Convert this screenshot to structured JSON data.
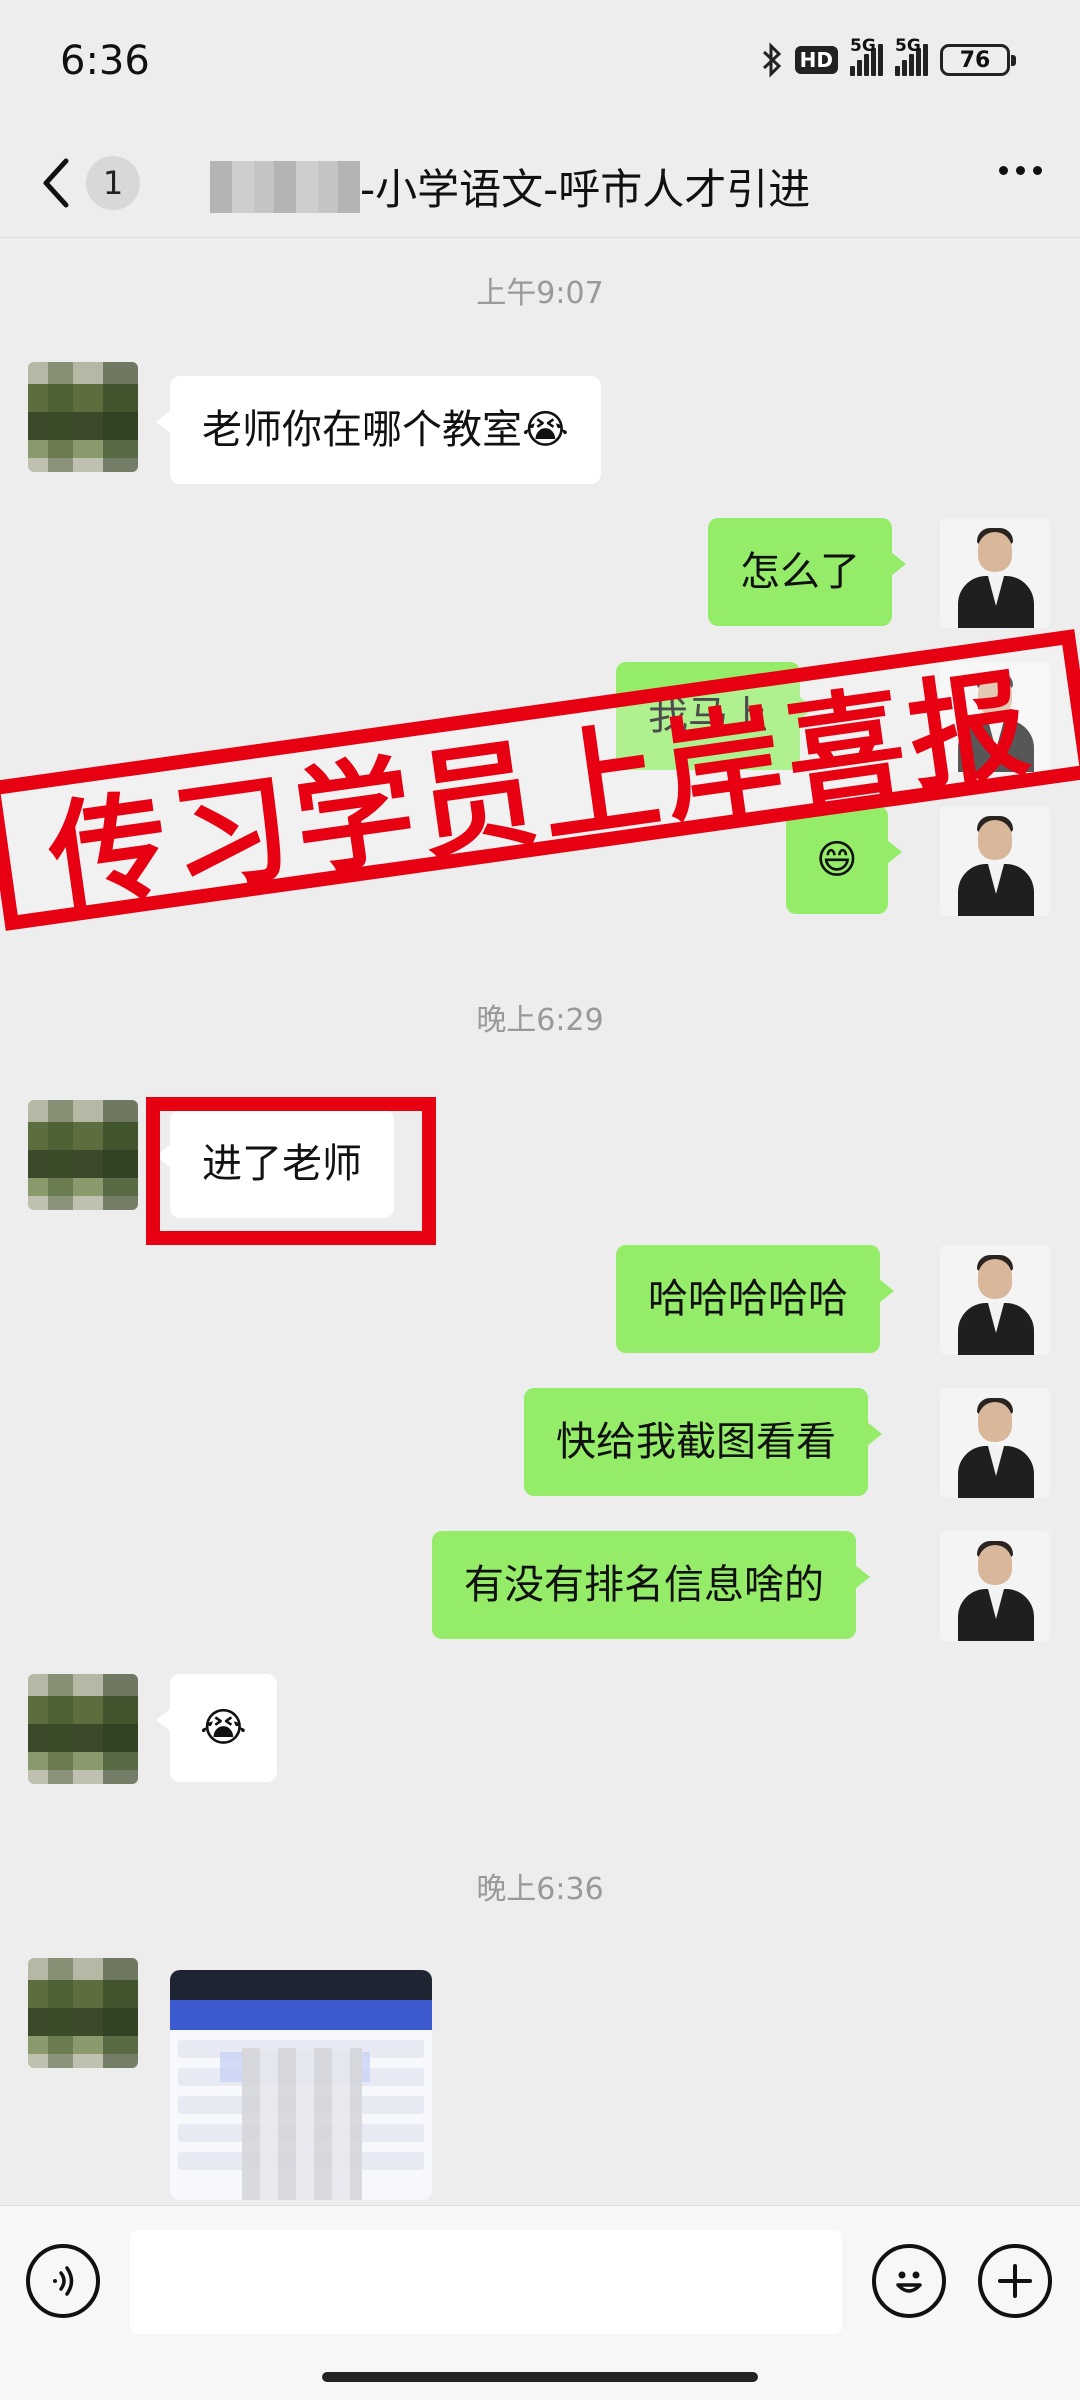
{
  "status_bar": {
    "time": "6:36",
    "hd_badge": "HD",
    "network_1": "5G",
    "network_2": "5G",
    "battery": "76"
  },
  "header": {
    "unread_count": "1",
    "title": "-小学语文-呼市人才引进",
    "back_icon": "chevron-left-icon",
    "more_icon": "more-dots-icon"
  },
  "messages": {
    "ts1": "上午9:07",
    "m1": "老师你在哪个教室😭",
    "m2": "怎么了",
    "m3": "我马上",
    "m4": "😄",
    "ts2": "晚上6:29",
    "m5": "进了老师",
    "m6": "哈哈哈哈哈",
    "m7": "快给我截图看看",
    "m8": "有没有排名信息啥的",
    "m9": "😭",
    "ts3": "晚上6:36"
  },
  "overlay": {
    "stamp_text": "传习学员上岸喜报",
    "color": "#e60012"
  },
  "input_bar": {
    "voice_icon": "voice-icon",
    "emoji_icon": "emoji-icon",
    "plus_icon": "plus-icon"
  }
}
